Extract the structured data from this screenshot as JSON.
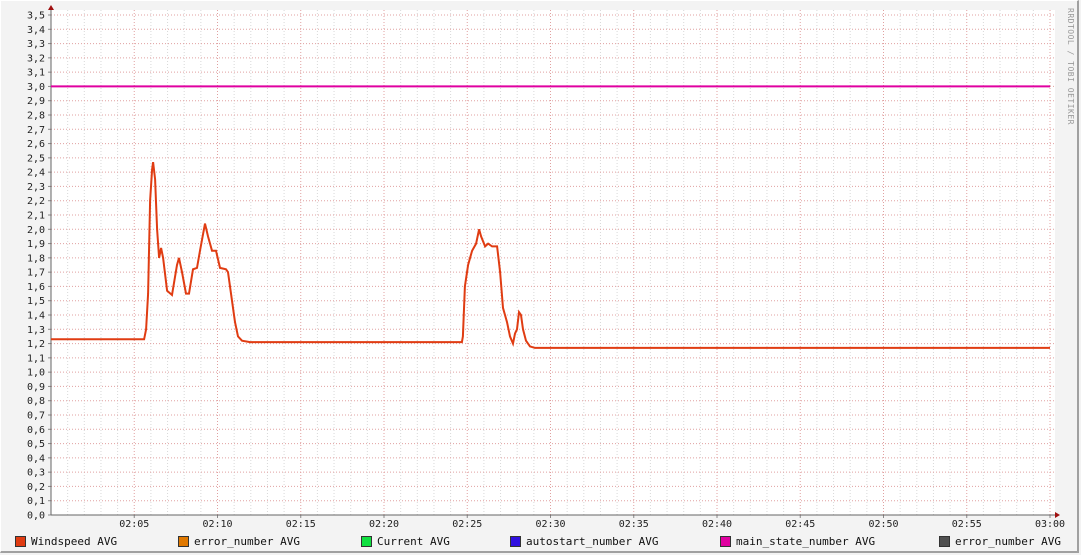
{
  "chart_data": {
    "type": "line",
    "title": "",
    "xlabel": "",
    "ylabel": "",
    "ylim": [
      0,
      3.5
    ],
    "xlim_minutes_after_0200": [
      0,
      60
    ],
    "grid": true,
    "yticks": [
      "0,0",
      "0,1",
      "0,2",
      "0,3",
      "0,4",
      "0,5",
      "0,6",
      "0,7",
      "0,8",
      "0,9",
      "1,0",
      "1,1",
      "1,2",
      "1,3",
      "1,4",
      "1,5",
      "1,6",
      "1,7",
      "1,8",
      "1,9",
      "2,0",
      "2,1",
      "2,2",
      "2,3",
      "2,4",
      "2,5",
      "2,6",
      "2,7",
      "2,8",
      "2,9",
      "3,0",
      "3,1",
      "3,2",
      "3,3",
      "3,4",
      "3,5"
    ],
    "xticks": [
      "02:05",
      "02:10",
      "02:15",
      "02:20",
      "02:25",
      "02:30",
      "02:35",
      "02:40",
      "02:45",
      "02:50",
      "02:55",
      "03:00"
    ],
    "series": [
      {
        "name": "Windspeed AVG",
        "color": "#e03c12",
        "x_minutes": [
          0,
          5.59,
          5.71,
          5.83,
          5.95,
          6.07,
          6.13,
          6.25,
          6.37,
          6.49,
          6.61,
          6.73,
          6.97,
          7.27,
          7.57,
          7.69,
          7.87,
          8.11,
          8.29,
          8.53,
          8.77,
          8.95,
          9.25,
          9.43,
          9.67,
          9.91,
          10.15,
          10.51,
          10.63,
          10.87,
          11.05,
          11.23,
          11.47,
          11.95,
          24.68,
          24.74,
          24.86,
          25.05,
          25.29,
          25.53,
          25.71,
          25.83,
          26.07,
          26.25,
          26.49,
          26.79,
          26.97,
          27.15,
          27.39,
          27.57,
          27.75,
          27.87,
          27.99,
          28.11,
          28.23,
          28.35,
          28.53,
          28.77,
          29.07,
          60
        ],
        "values": [
          1.23,
          1.23,
          1.3,
          1.55,
          2.2,
          2.42,
          2.47,
          2.35,
          2.0,
          1.8,
          1.87,
          1.8,
          1.57,
          1.54,
          1.75,
          1.8,
          1.7,
          1.55,
          1.55,
          1.72,
          1.73,
          1.85,
          2.04,
          1.95,
          1.85,
          1.85,
          1.73,
          1.72,
          1.7,
          1.5,
          1.35,
          1.25,
          1.22,
          1.21,
          1.21,
          1.25,
          1.6,
          1.75,
          1.85,
          1.9,
          2.0,
          1.95,
          1.88,
          1.9,
          1.88,
          1.88,
          1.7,
          1.45,
          1.35,
          1.25,
          1.2,
          1.27,
          1.3,
          1.42,
          1.4,
          1.3,
          1.22,
          1.18,
          1.17,
          1.17
        ]
      },
      {
        "name": "error_number AVG",
        "color": "#e07800",
        "x_minutes": [],
        "values": []
      },
      {
        "name": "Current AVG",
        "color": "#10e040",
        "x_minutes": [],
        "values": []
      },
      {
        "name": "autostart_number AVG",
        "color": "#3010e0",
        "x_minutes": [],
        "values": []
      },
      {
        "name": "main_state_number AVG",
        "color": "#e000a0",
        "x_minutes": [
          0,
          60
        ],
        "values": [
          3.0,
          3.0
        ]
      },
      {
        "name": "error_number AVG",
        "color": "#505050",
        "x_minutes": [],
        "values": []
      }
    ],
    "legend_placement": "bottom"
  },
  "watermark": "RRDTOOL / TOBI OETIKER"
}
